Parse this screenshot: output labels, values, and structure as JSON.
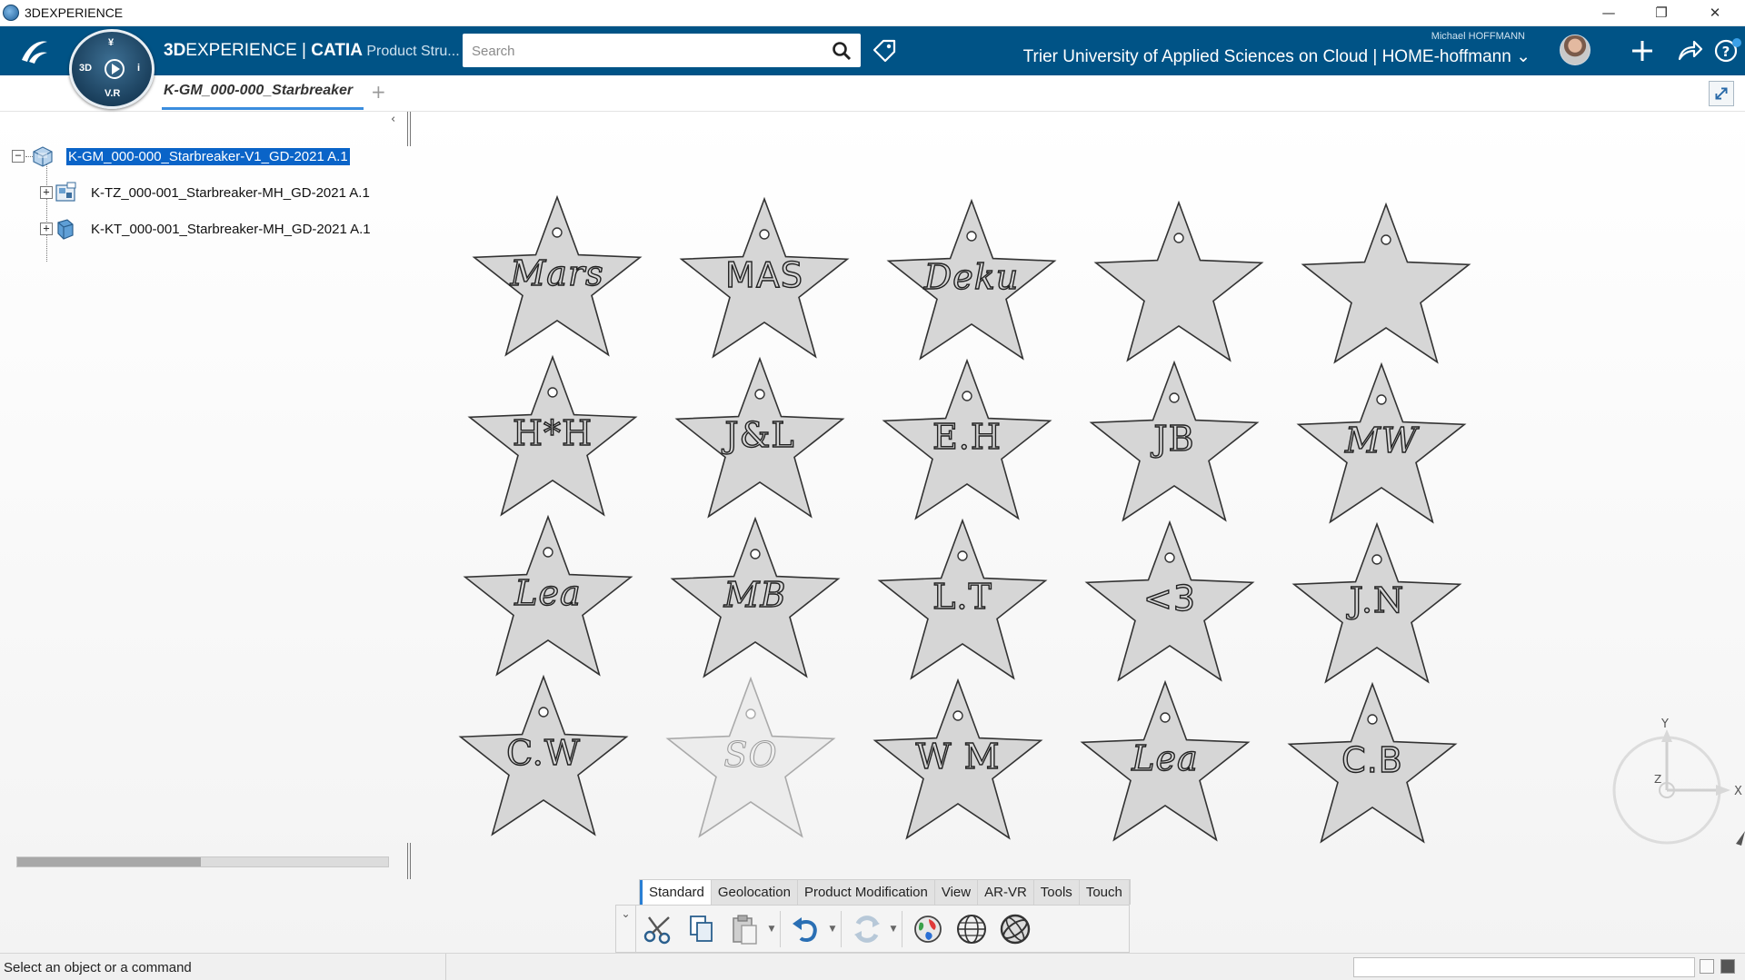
{
  "os": {
    "title": "3DEXPERIENCE",
    "minimize": "—",
    "restore": "❐",
    "close": "✕"
  },
  "app_bar": {
    "brand_bold": "3D",
    "brand_rest": "EXPERIENCE | ",
    "brand_app": "CATIA",
    "brand_role": " Product Stru...",
    "search_placeholder": "Search",
    "user_name": "Michael HOFFMANN",
    "tenant": "Trier University of Applied Sciences on Cloud | HOME-hoffmann",
    "tenant_caret": "⌄",
    "compass": {
      "left": "3D",
      "right": "i",
      "bottom": "V.R",
      "top": "¥"
    }
  },
  "tab": {
    "title": "K-GM_000-000_Starbreaker",
    "add": "+"
  },
  "tree": {
    "collapse_arrow": "‹",
    "root": {
      "expander": "−",
      "label": "K-GM_000-000_Starbreaker-V1_GD-2021 A.1"
    },
    "children": [
      {
        "expander": "+",
        "label": "K-TZ_000-001_Starbreaker-MH_GD-2021 A.1"
      },
      {
        "expander": "+",
        "label": "K-KT_000-001_Starbreaker-MH_GD-2021 A.1"
      }
    ]
  },
  "stars": [
    {
      "text": "Mars",
      "style": "script"
    },
    {
      "text": "MAS",
      "style": "sans"
    },
    {
      "text": "Deku",
      "style": "script"
    },
    {
      "text": "",
      "style": "sans"
    },
    {
      "text": "",
      "style": "sans"
    },
    {
      "text": "H*H",
      "style": "serif"
    },
    {
      "text": "J&L",
      "style": "serif"
    },
    {
      "text": "E.H",
      "style": "serif"
    },
    {
      "text": "JB",
      "style": "serif"
    },
    {
      "text": "MW",
      "style": "script"
    },
    {
      "text": "Lea",
      "style": "script"
    },
    {
      "text": "MB",
      "style": "script"
    },
    {
      "text": "L.T",
      "style": "serif"
    },
    {
      "text": "<3",
      "style": "sans"
    },
    {
      "text": "J.N",
      "style": "serif"
    },
    {
      "text": "C.W",
      "style": "serif"
    },
    {
      "text": "SO",
      "style": "script",
      "ghost": true
    },
    {
      "text": "W M",
      "style": "serif"
    },
    {
      "text": "Lea",
      "style": "script"
    },
    {
      "text": "C.B",
      "style": "sans"
    }
  ],
  "axis": {
    "x": "X",
    "y": "Y",
    "z": "Z"
  },
  "action_tabs": [
    "Standard",
    "Geolocation",
    "Product Modification",
    "View",
    "AR-VR",
    "Tools",
    "Touch"
  ],
  "action_tab_active": "Standard",
  "action_expand": "⌄",
  "status": {
    "text": "Select an object or a command"
  },
  "colors": {
    "brand_bar": "#005386",
    "selection": "#0a64c8",
    "active_tab": "#2a7fd4",
    "star_fill": "#d6d6d6"
  },
  "icons": {
    "search": "search-icon",
    "tag": "tag-icon",
    "add": "plus-icon",
    "share": "share-icon",
    "help": "help-icon",
    "cut": "scissors-icon",
    "copy": "copy-icon",
    "paste": "paste-icon",
    "undo": "undo-icon",
    "update": "update-icon",
    "fly": "globe-icon"
  }
}
